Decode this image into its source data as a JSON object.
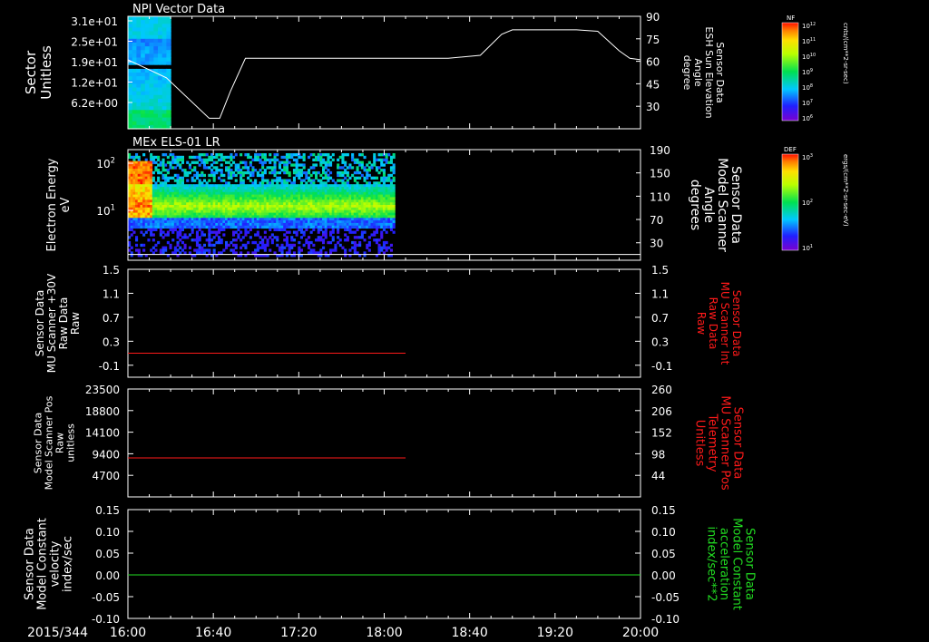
{
  "colors": {
    "background": "#000000",
    "frame": "#ffffff",
    "red_trace": "#ff1a1a",
    "green_trace": "#22dd22"
  },
  "x_axis": {
    "date": "2015/344",
    "ticks": [
      "16:00",
      "16:40",
      "17:20",
      "18:00",
      "18:40",
      "19:20",
      "20:00"
    ]
  },
  "colorbars": [
    {
      "label": "NF",
      "unit": "cnts/(cm**2-sr-sec)",
      "ticks": [
        "10^12",
        "10^11",
        "10^10",
        "10^9",
        "10^8",
        "10^7",
        "10^6"
      ]
    },
    {
      "label": "DEF",
      "unit": "ergs/(cm**2-sr-sec-eV)",
      "ticks": [
        "10^3",
        "10^2",
        "10^1"
      ]
    }
  ],
  "chart_data": [
    {
      "type": "heatmap",
      "title": "NPI Vector Data",
      "ylabel": [
        "Sector",
        "Unitless"
      ],
      "yticks": [
        "3.1e+01",
        "2.5e+01",
        "1.9e+01",
        "1.2e+01",
        "6.2e+00"
      ],
      "heatmap_time_range": [
        "16:00",
        "16:20"
      ],
      "overlay": {
        "type": "line",
        "ylabel": [
          "Sensor Data",
          "ESH Sun Elevation",
          "Angle",
          "degree"
        ],
        "ylim": [
          15,
          90
        ],
        "yticks": [
          30,
          45,
          60,
          75,
          90
        ],
        "x": [
          "16:00",
          "16:18",
          "16:38",
          "16:43",
          "16:48",
          "16:55",
          "17:10",
          "17:30",
          "18:00",
          "18:30",
          "18:45",
          "18:55",
          "19:00",
          "19:30",
          "19:40",
          "19:50",
          "19:55",
          "20:00"
        ],
        "y": [
          61,
          49,
          22,
          22,
          40,
          62,
          62,
          62,
          62,
          62,
          64,
          78,
          81,
          81,
          80,
          67,
          62,
          61
        ]
      }
    },
    {
      "type": "heatmap",
      "title": "MEx ELS-01 LR",
      "ylabel": [
        "Electron Energy",
        "eV"
      ],
      "yticks": [
        "10^2",
        "10^1"
      ],
      "heatmap_time_range": [
        "16:00",
        "18:05"
      ],
      "overlay": {
        "type": "line",
        "ylabel": [
          "Sensor Data",
          "Model Scanner",
          "Angle",
          "degrees"
        ],
        "ylim": [
          0,
          190
        ],
        "yticks": [
          30,
          70,
          110,
          150,
          190
        ],
        "x": [
          "16:00",
          "20:00"
        ],
        "y": [
          10,
          10
        ]
      }
    },
    {
      "type": "line",
      "ylabel_left": [
        "Sensor Data",
        "MU Scanner +30V",
        "Raw Data",
        "Raw"
      ],
      "ylabel_right": [
        "Sensor Data",
        "MU Scanner Int",
        "Raw Data",
        "Raw"
      ],
      "ylim": [
        -0.3,
        1.5
      ],
      "yticks": [
        "1.5",
        "1.1",
        "0.7",
        "0.3",
        "-0.1"
      ],
      "series": [
        {
          "x": [
            "16:00",
            "18:10"
          ],
          "y": [
            0.1,
            0.1
          ]
        }
      ]
    },
    {
      "type": "line",
      "ylabel_left": [
        "Sensor Data",
        "Model Scanner Pos",
        "Raw",
        "unitless"
      ],
      "ylabel_right": [
        "Sensor Data",
        "MU Scanner Pos",
        "Telemetry",
        "Unitless"
      ],
      "ylim": [
        0,
        23500
      ],
      "yticks": [
        "23500",
        "18800",
        "14100",
        "9400",
        "4700"
      ],
      "yticks_right": [
        "260",
        "206",
        "152",
        "98",
        "44"
      ],
      "series": [
        {
          "x": [
            "16:00",
            "18:10"
          ],
          "y": [
            8500,
            8500
          ]
        }
      ]
    },
    {
      "type": "line",
      "ylabel_left": [
        "Sensor Data",
        "Model Constant",
        "velocity",
        "index/sec"
      ],
      "ylabel_right": [
        "Sensor Data",
        "Model Constant",
        "acceleration",
        "index/sec**2"
      ],
      "ylim": [
        -0.1,
        0.15
      ],
      "yticks": [
        "0.15",
        "0.10",
        "0.05",
        "0.00",
        "-0.05",
        "-0.10"
      ],
      "series": [
        {
          "x": [
            "16:00",
            "20:00"
          ],
          "y": [
            0,
            0
          ]
        }
      ]
    }
  ]
}
